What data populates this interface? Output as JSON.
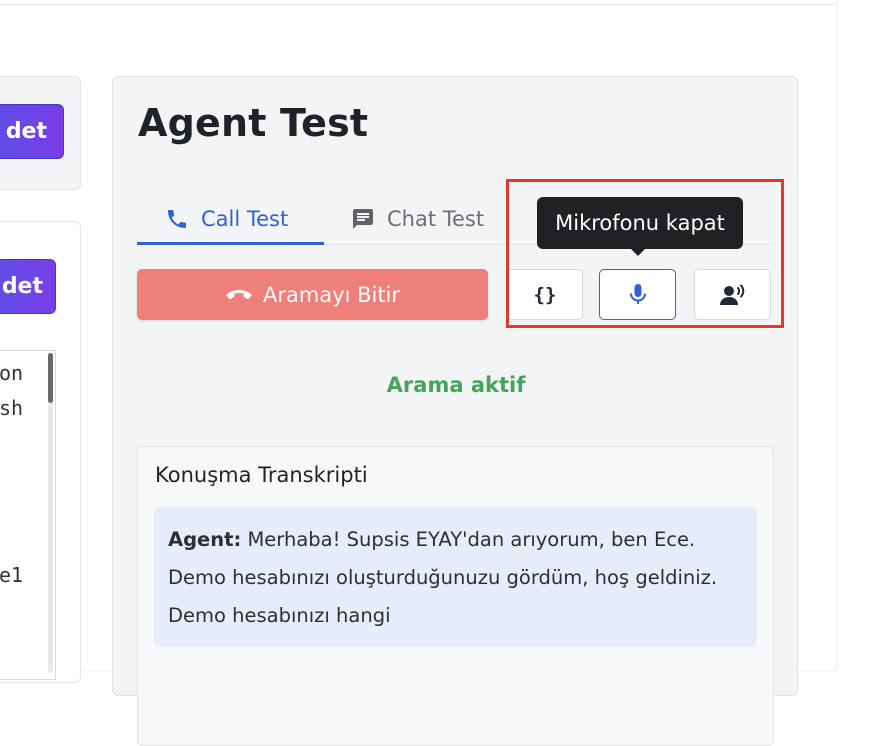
{
  "left": {
    "button_top_label": "det",
    "button_bottom_label": "det",
    "list_fragments": [
      "on",
      "sh",
      "e1"
    ]
  },
  "main": {
    "title": "Agent Test",
    "tabs": [
      {
        "label": "Call Test",
        "icon": "phone-icon",
        "active": true
      },
      {
        "label": "Chat Test",
        "icon": "chat-icon",
        "active": false
      }
    ],
    "end_call_label": "Aramayı Bitir",
    "icon_buttons": [
      "braces-icon",
      "microphone-icon",
      "speaker-voice-icon"
    ],
    "tooltip": "Mikrofonu kapat",
    "status": "Arama aktif",
    "transcript": {
      "title": "Konuşma Transkripti",
      "speaker": "Agent:",
      "message": "Merhaba! Supsis EYAY'dan arıyorum, ben Ece. Demo hesabınızı oluşturduğunuzu gördüm, hoş geldiniz. Demo hesabınızı hangi"
    }
  },
  "colors": {
    "accent_blue": "#2f62d6",
    "end_call_red": "#ef8079",
    "status_green": "#46a35a",
    "purple": "#5b4ee6",
    "highlight_red": "#e0392b"
  }
}
